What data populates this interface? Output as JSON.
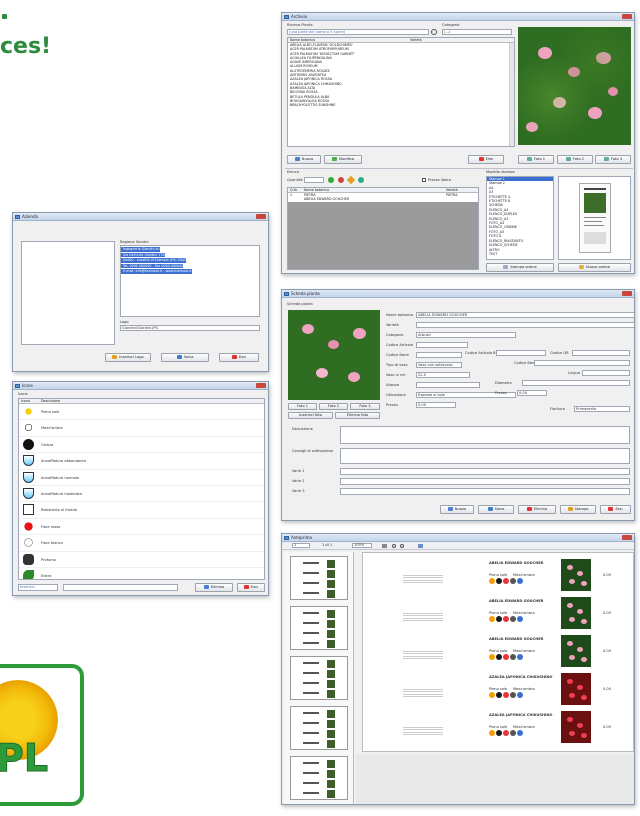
{
  "headline_fragment": "ces!",
  "colors": {
    "headline": "#2e8b3e",
    "logo_green": "#2e9b3b",
    "logo_yellow": "#f3b90a",
    "titlebar": "#c4d5ea",
    "selection": "#3b6fd0",
    "close": "#c9463d"
  },
  "archive_window": {
    "title": "Archivio",
    "search_label": "Ricerca Pianta",
    "search_placeholder": "(una parte del nome o il nome)",
    "category_label": "Categoria",
    "category_value": "(...)",
    "columns": [
      "Nome botanico",
      "Varietà"
    ],
    "items": [
      "ABELIA ALBO-FLAVENS 'GOLDCHIMES'",
      "ACER PALMATUM ATROPURPUREUM",
      "ACER PALMATUM 'DISSECTUM GARNET'",
      "ACHILLEA FILIPENDULINA",
      "AGAVE AMERICANA",
      "ALLIUM ROSEUM",
      "ALSTROEMERIA ROSATA",
      "ANTHEMIS ARGENTEA",
      "AZALEA JAPONICA ROSSA",
      "AZALEA JAPONICA CHIKUSHINO",
      "BAMBUSA ALTA",
      "BEGONIA ROSSA",
      "BETULA PENDULA ALBA",
      "BOUGAINVILLEA ROSSA",
      "BRACHYGLOTTIS SUNSHINE"
    ],
    "buttons": {
      "new": "Nuova",
      "modify": "Modifica",
      "delete": "Elim",
      "photo1": "Foto 1",
      "photo2": "Foto 2",
      "photo3": "Foto 3"
    },
    "order_section": {
      "title": "Elenco",
      "qty_label": "Quantità",
      "free_price_label": "Prezzo libero",
      "columns": [
        "Q.tà",
        "Nome botanico",
        "Varietà"
      ],
      "rows": [
        {
          "qty": "1",
          "name": "PIETRA",
          "variety": "PIETRA"
        },
        {
          "qty": "",
          "name": "ABELIA EDWARD GOUCHER",
          "variety": ""
        }
      ]
    },
    "layouts_label": "Modello stampa",
    "layouts": [
      "Stampe 1",
      "Stampe 2",
      "A4",
      "A3",
      "ETICHETTE 4",
      "ETICHETTE 8",
      "SCHEDA",
      "ELENCO_A4",
      "ELENCO_DUPLEX",
      "ELENCO_A3",
      "FOTO_A4",
      "ELENCO_ORDINE",
      "FOTO_A3",
      "FOTO 8",
      "ELENCO_RIASSUNTO",
      "ELENCO_SCHEDE",
      "ALTRO",
      "TEST"
    ],
    "print_buttons": {
      "print_order": "Stampa ordine",
      "new_order": "Nuovo ordine"
    }
  },
  "azienda_window": {
    "title": "Azienda",
    "company_label": "Ragione Sociale",
    "company_lines": [
      "Ingegneria Giardini srl",
      "Via Dell'Arte Giardini 278",
      "00000 - Località di Esempio (PV) ITALY",
      "Tel. 0000 000000 - Fax 0000 000000",
      "E-mail: info@esempio.it - www.esempio.it"
    ],
    "logo_label": "Logo",
    "logo_value": "Giardini\\Giardini.JPG",
    "buttons": {
      "insert_logo": "Inserisci Logo",
      "save": "Salva",
      "exit": "Esci"
    }
  },
  "icons_window": {
    "title": "Icone",
    "header": "Icone",
    "columns": [
      "Icona",
      "Descrizione"
    ],
    "items": [
      "Pieno sole",
      "Mezz'ombra",
      "Ombra",
      "Annaffiatura abbondante",
      "Annaffiatura normale",
      "Annaffiatura moderata",
      "Resistente al freddo",
      "Fiore rosso",
      "Fiore bianco",
      "Profumo",
      "Edera"
    ],
    "buttons": {
      "insert": "Inserisci",
      "delete": "Elimina",
      "exit": "Esci"
    }
  },
  "scheda_window": {
    "title": "Scheda pianta",
    "section_label": "Scheda pianta",
    "fields": [
      {
        "label": "Nome botanico",
        "value": "ABELIA EDWARD GOUCHER"
      },
      {
        "label": "Varietà",
        "value": ""
      },
      {
        "label": "Categoria",
        "value": "Arbusti"
      },
      {
        "label": "Codice Articolo",
        "value": ""
      },
      {
        "label": "Codice Barre",
        "value": ""
      },
      {
        "label": "Tipo di vaso",
        "value": "Vaso con sottovaso"
      },
      {
        "label": "Vaso in cm",
        "value": "22.0"
      },
      {
        "label": "Altezza",
        "value": ""
      },
      {
        "label": "Ubicazione",
        "value": "Esposta al sole"
      },
      {
        "label": "Prezzo",
        "value": "0.00"
      }
    ],
    "right_labels": {
      "code_article_b": "Codice Articolo B",
      "code_b": "Codice Barre B",
      "code_qr": "Codice QR",
      "lang": "Lingua",
      "price2": "Prezzo",
      "price2_value": "0.00",
      "diameter": "Diametro",
      "fioritura": "Fioritura",
      "fioritura_value": "Primaverile"
    },
    "photo_buttons": {
      "photo1": "Foto 1",
      "photo2": "Foto 2",
      "photo3": "Foto 3",
      "insert_photo": "Inserisci foto",
      "delete_photo": "Elimina foto"
    },
    "text_labels": [
      "Descrizione",
      "Consigli di coltivazione",
      "Varie 1",
      "Varie 2",
      "Varie 3"
    ],
    "buttons": {
      "new": "Nuova",
      "save": "Salva",
      "delete": "Elimina",
      "print": "Stampa",
      "exit": "Esci"
    }
  },
  "preview_window": {
    "title": "Anteprima",
    "zoom": "100%",
    "page": "1",
    "page_total": "1 di 1",
    "cards": [
      {
        "name": "ABELIA EDWARD GOUCHER",
        "price": "0.00"
      },
      {
        "name": "ABELIA EDWARD GOUCHER",
        "price": "0.00"
      },
      {
        "name": "ABELIA EDWARD GOUCHER",
        "price": "0.00"
      },
      {
        "name": "AZALEA JAPONICA CHIKUSHINO",
        "price": "0.00"
      },
      {
        "name": "AZALEA JAPONICA CHIKUSHINO",
        "price": "0.00"
      }
    ],
    "caption_left": "Pieno sole",
    "caption_right": "Mezz'ombra"
  },
  "logo_text": "PL"
}
